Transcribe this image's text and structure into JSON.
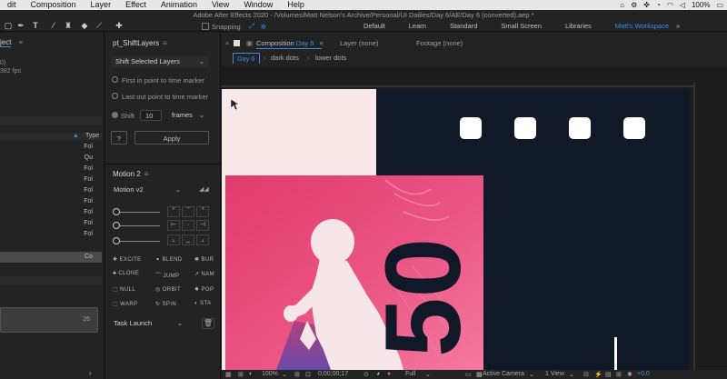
{
  "menubar": {
    "items": [
      "dit",
      "Composition",
      "Layer",
      "Effect",
      "Animation",
      "View",
      "Window",
      "Help"
    ],
    "battery": "100%"
  },
  "toolbar": {
    "app_title": "Adobe After Effects 2020 - /Volumes/Matt Nelson's Archive/Personal/UI Dailies/Day 6/AE/Day 6 (converted).aep *",
    "snapping_label": "Snapping",
    "workspaces": [
      "Default",
      "Learn",
      "Standard",
      "Small Screen",
      "Libraries",
      "Matt's Workspace"
    ],
    "active_workspace": "Matt's Workspace"
  },
  "project_panel": {
    "tab_label": "ject",
    "info_line1": "0)",
    "info_line2": "382 fps",
    "type_header": "Type",
    "rows": [
      "Fol",
      "Qu",
      "Fol",
      "Fol",
      "Fol",
      "Fol",
      "Fol",
      "Fol",
      "Fol",
      "Co"
    ],
    "bottom_value": "26"
  },
  "shift_layers": {
    "title": "pt_ShiftLayers",
    "mode": "Shift Selected Layers",
    "option_first": "First in point to time marker",
    "option_last": "Last out point to time marker",
    "option_shift": "Shift",
    "shift_value": "10",
    "shift_unit": "frames",
    "help_label": "?",
    "apply_label": "Apply"
  },
  "motion": {
    "title": "Motion 2",
    "version": "Motion v2",
    "buttons": [
      [
        "EXCITE",
        "BLEND",
        "BUR"
      ],
      [
        "CLONE",
        "JUMP",
        "NAM"
      ],
      [
        "NULL",
        "ORBIT",
        "POP"
      ],
      [
        "WARP",
        "SPIN",
        "STA"
      ]
    ],
    "task_launch": "Task Launch"
  },
  "composition": {
    "tab_label": "Composition",
    "comp_name": "Day 6",
    "layer_tab": "Layer (none)",
    "footage_tab": "Footage (none)",
    "breadcrumbs": [
      "Day 6",
      "dark dots",
      "lower dots"
    ],
    "poster_number": "50",
    "colors": {
      "light_bg": "#f8e8e8",
      "dark_bg": "#111827",
      "pink": "#e0406e",
      "magenta": "#f06090"
    }
  },
  "statusbar": {
    "zoom": "100%",
    "timecode": "0;00;00;17",
    "resolution": "Full",
    "camera": "Active Camera",
    "views": "1 View",
    "exposure": "+0.0"
  }
}
